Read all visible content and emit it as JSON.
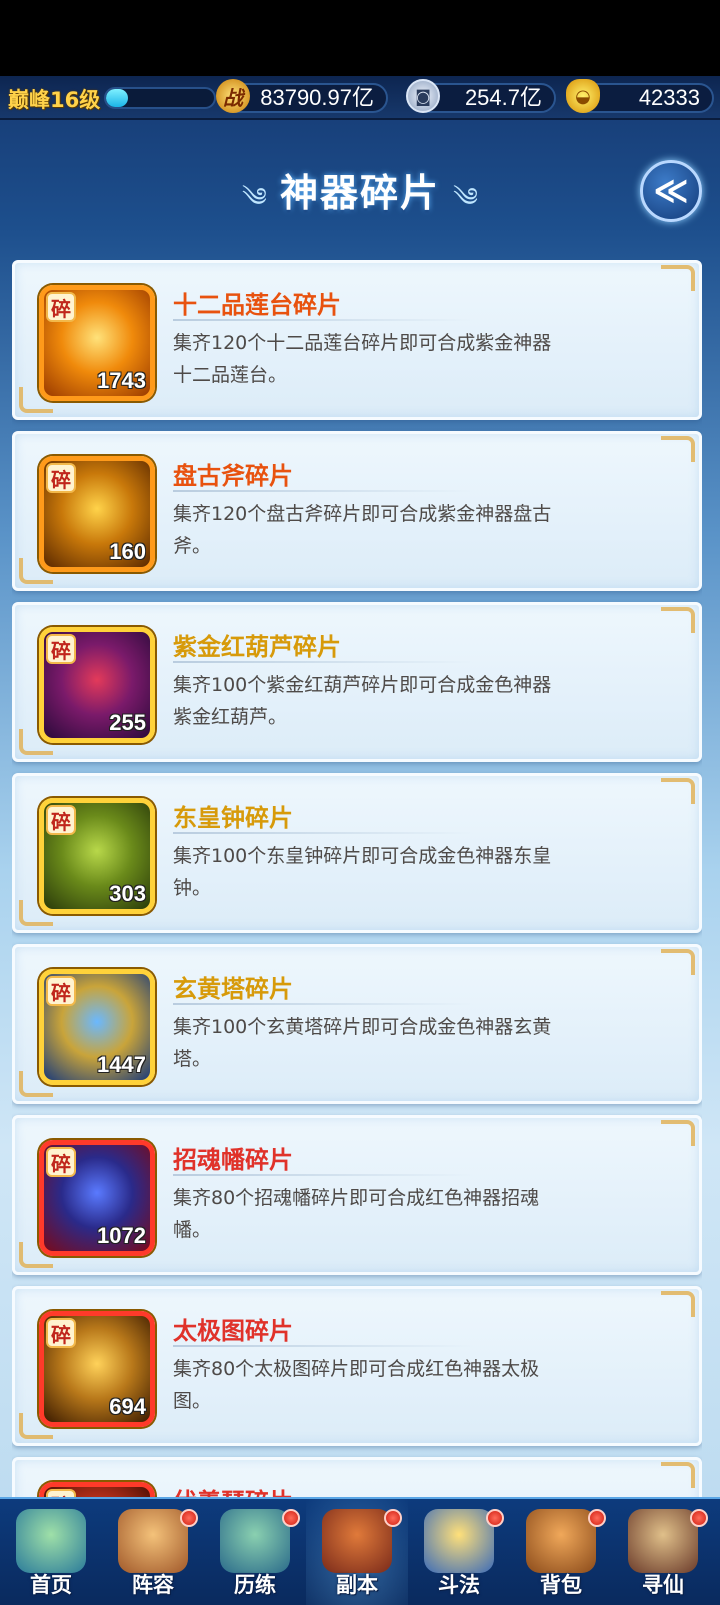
{
  "header": {
    "level_label": "巅峰16级",
    "level_progress": 0.2,
    "power_icon_glyph": "战",
    "power_value": "83790.97亿",
    "silver_value": "254.7亿",
    "gold_value": "42333"
  },
  "page": {
    "title": "神器碎片",
    "title_swirl_left": "༄",
    "title_swirl_right": "༄"
  },
  "fragments": [
    {
      "name": "十二品莲台碎片",
      "count": "1743",
      "badge": "碎",
      "desc": "集齐120个十二品莲台碎片即可合成紫金神器十二品莲台。",
      "name_color": "#e8520f",
      "frame": "#ff9a1a",
      "art": [
        "#ffe27a",
        "#f08a0b",
        "#9a3a00"
      ]
    },
    {
      "name": "盘古斧碎片",
      "count": "160",
      "badge": "碎",
      "desc": "集齐120个盘古斧碎片即可合成紫金神器盘古斧。",
      "name_color": "#e8520f",
      "frame": "#ff9a1a",
      "art": [
        "#ffd34a",
        "#c8780a",
        "#5a2800"
      ]
    },
    {
      "name": "紫金红葫芦碎片",
      "count": "255",
      "badge": "碎",
      "desc": "集齐100个紫金红葫芦碎片即可合成金色神器紫金红葫芦。",
      "name_color": "#d79a0a",
      "frame": "#ffd23a",
      "art": [
        "#e33a5a",
        "#7a1a6a",
        "#2a0a3a"
      ]
    },
    {
      "name": "东皇钟碎片",
      "count": "303",
      "badge": "碎",
      "desc": "集齐100个东皇钟碎片即可合成金色神器东皇钟。",
      "name_color": "#d79a0a",
      "frame": "#ffd23a",
      "art": [
        "#b8d84a",
        "#6a8a1a",
        "#2a3a0a"
      ]
    },
    {
      "name": "玄黄塔碎片",
      "count": "1447",
      "badge": "碎",
      "desc": "集齐100个玄黄塔碎片即可合成金色神器玄黄塔。",
      "name_color": "#d79a0a",
      "frame": "#ffd23a",
      "art": [
        "#6ab8ff",
        "#c9a43a",
        "#1a3a7a"
      ]
    },
    {
      "name": "招魂幡碎片",
      "count": "1072",
      "badge": "碎",
      "desc": "集齐80个招魂幡碎片即可合成红色神器招魂幡。",
      "name_color": "#e0322a",
      "frame": "#ff3a2a",
      "art": [
        "#5a7aff",
        "#2a2a8a",
        "#7a0a1a"
      ]
    },
    {
      "name": "太极图碎片",
      "count": "694",
      "badge": "碎",
      "desc": "集齐80个太极图碎片即可合成红色神器太极图。",
      "name_color": "#e0322a",
      "frame": "#ff3a2a",
      "art": [
        "#ffd25a",
        "#b8781a",
        "#3a1a00"
      ]
    },
    {
      "name": "伏羲琴碎片",
      "count": "",
      "badge": "碎",
      "desc": "",
      "name_color": "#e0322a",
      "frame": "#ff3a2a",
      "art": [
        "#ff7a4a",
        "#b8301a",
        "#3a0a00"
      ]
    }
  ],
  "bottom_nav": [
    {
      "label": "首页",
      "icon": "home-icon",
      "dot": false,
      "art": [
        "#9fe0a8",
        "#2a7a9a"
      ]
    },
    {
      "label": "阵容",
      "icon": "lineup-icon",
      "dot": true,
      "art": [
        "#f4c27a",
        "#a0582a"
      ]
    },
    {
      "label": "历练",
      "icon": "training-icon",
      "dot": true,
      "art": [
        "#8ad0b0",
        "#2a6a8a"
      ]
    },
    {
      "label": "副本",
      "icon": "dungeon-icon",
      "dot": true,
      "art": [
        "#e07a3a",
        "#7a2a1a"
      ]
    },
    {
      "label": "斗法",
      "icon": "battle-icon",
      "dot": true,
      "art": [
        "#ffe07a",
        "#3a6ab8"
      ]
    },
    {
      "label": "背包",
      "icon": "bag-icon",
      "dot": true,
      "art": [
        "#f0a85a",
        "#8a4a1a"
      ]
    },
    {
      "label": "寻仙",
      "icon": "seek-immortal-icon",
      "dot": true,
      "art": [
        "#e0c08a",
        "#6a3a2a"
      ]
    }
  ]
}
